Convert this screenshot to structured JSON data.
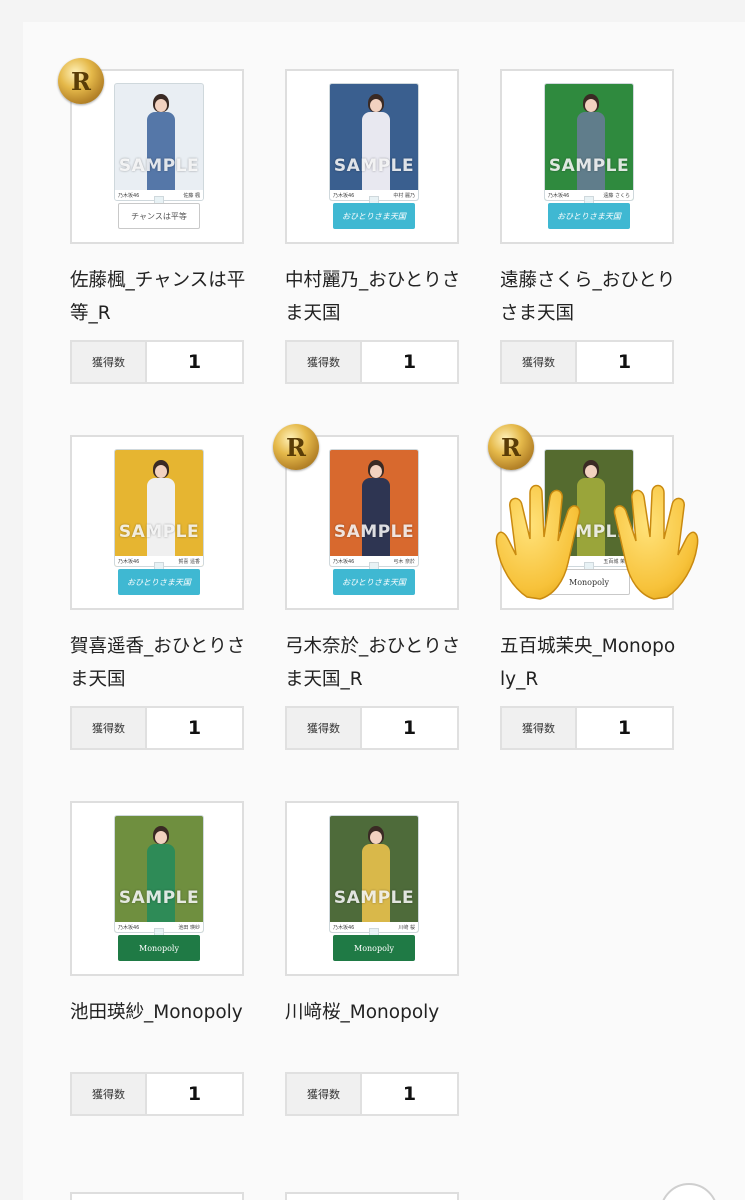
{
  "badge_letter": "R",
  "items": [
    {
      "title": "佐藤楓_チャンスは平等_R",
      "count_label": "獲得数",
      "count": "1",
      "rare": true,
      "stand_text": "チャンスは平等",
      "caption": "佐藤 楓",
      "photo_colors": {
        "bg": "#e9eef3",
        "body": "#5577a8"
      }
    },
    {
      "title": "中村麗乃_おひとりさま天国",
      "count_label": "獲得数",
      "count": "1",
      "rare": false,
      "stand_text": "おひとりさま天国",
      "caption": "中村 麗乃",
      "photo_colors": {
        "bg": "#3a5f8f",
        "body": "#e8e8f0"
      }
    },
    {
      "title": "遠藤さくら_おひとりさま天国",
      "count_label": "獲得数",
      "count": "1",
      "rare": false,
      "stand_text": "おひとりさま天国",
      "caption": "遠藤 さくら",
      "photo_colors": {
        "bg": "#2f8a3e",
        "body": "#607d8b"
      }
    },
    {
      "title": "賀喜遥香_おひとりさま天国",
      "count_label": "獲得数",
      "count": "1",
      "rare": false,
      "stand_text": "おひとりさま天国",
      "caption": "賀喜 遥香",
      "photo_colors": {
        "bg": "#e6b531",
        "body": "#f0f0f0"
      }
    },
    {
      "title": "弓木奈於_おひとりさま天国_R",
      "count_label": "獲得数",
      "count": "1",
      "rare": true,
      "stand_text": "おひとりさま天国",
      "caption": "弓木 奈於",
      "photo_colors": {
        "bg": "#d8692e",
        "body": "#2e3552"
      }
    },
    {
      "title": "五百城茉央_Monopoly_R",
      "count_label": "獲得数",
      "count": "1",
      "rare": true,
      "stand_text": "Monopoly",
      "caption": "五百城 茉央",
      "photo_colors": {
        "bg": "#556b2f",
        "body": "#9aa53a"
      }
    },
    {
      "title": "池田瑛紗_Monopoly",
      "count_label": "獲得数",
      "count": "1",
      "rare": false,
      "stand_text": "Monopoly",
      "caption": "池田 瑛紗",
      "photo_colors": {
        "bg": "#6f8f3f",
        "body": "#2e8b57"
      }
    },
    {
      "title": "川﨑桜_Monopoly",
      "count_label": "獲得数",
      "count": "1",
      "rare": false,
      "stand_text": "Monopoly",
      "caption": "川﨑 桜",
      "photo_colors": {
        "bg": "#4e6b3a",
        "body": "#d9b84a"
      }
    }
  ],
  "sample_watermark": "SAMPLE",
  "group_logo": "乃木坂46"
}
